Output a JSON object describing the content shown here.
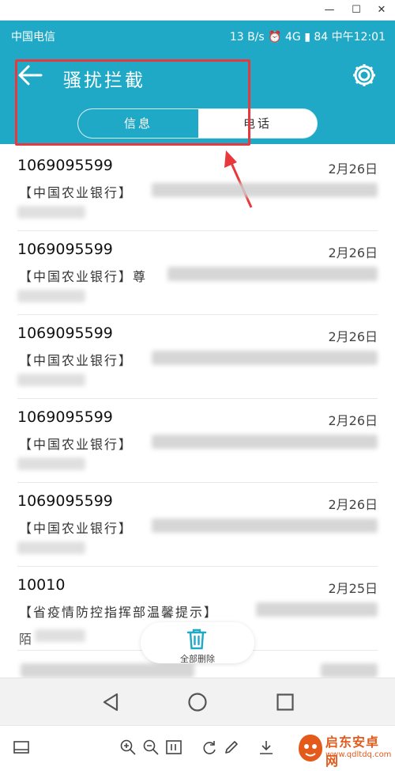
{
  "window": {
    "minimize": "—",
    "maximize": "☐",
    "close": "✕"
  },
  "statusbar": {
    "left": "中国电信",
    "right": "13 B/s ⏰ 4G ▮ 84 中午12:01"
  },
  "header": {
    "title": "骚扰拦截"
  },
  "tabs": [
    {
      "label": "信息",
      "active": true
    },
    {
      "label": "电话",
      "active": false
    }
  ],
  "messages": [
    {
      "sender": "1069095599",
      "date": "2月26日",
      "preview": "【中国农业银行】"
    },
    {
      "sender": "1069095599",
      "date": "2月26日",
      "preview": "【中国农业银行】尊"
    },
    {
      "sender": "1069095599",
      "date": "2月26日",
      "preview": "【中国农业银行】"
    },
    {
      "sender": "1069095599",
      "date": "2月26日",
      "preview": "【中国农业银行】"
    },
    {
      "sender": "1069095599",
      "date": "2月26日",
      "preview": "【中国农业银行】"
    },
    {
      "sender": "10010",
      "date": "2月25日",
      "preview": "【省疫情防控指挥部温馨提示】",
      "preview2": "陌"
    }
  ],
  "fab": {
    "label": "全部删除"
  },
  "watermark": {
    "line1": "启东安卓网",
    "line2": "www.qdltdq.com"
  },
  "colors": {
    "accent": "#20a9c6",
    "annotation": "#e8383b",
    "watermark": "#e35a1b"
  }
}
